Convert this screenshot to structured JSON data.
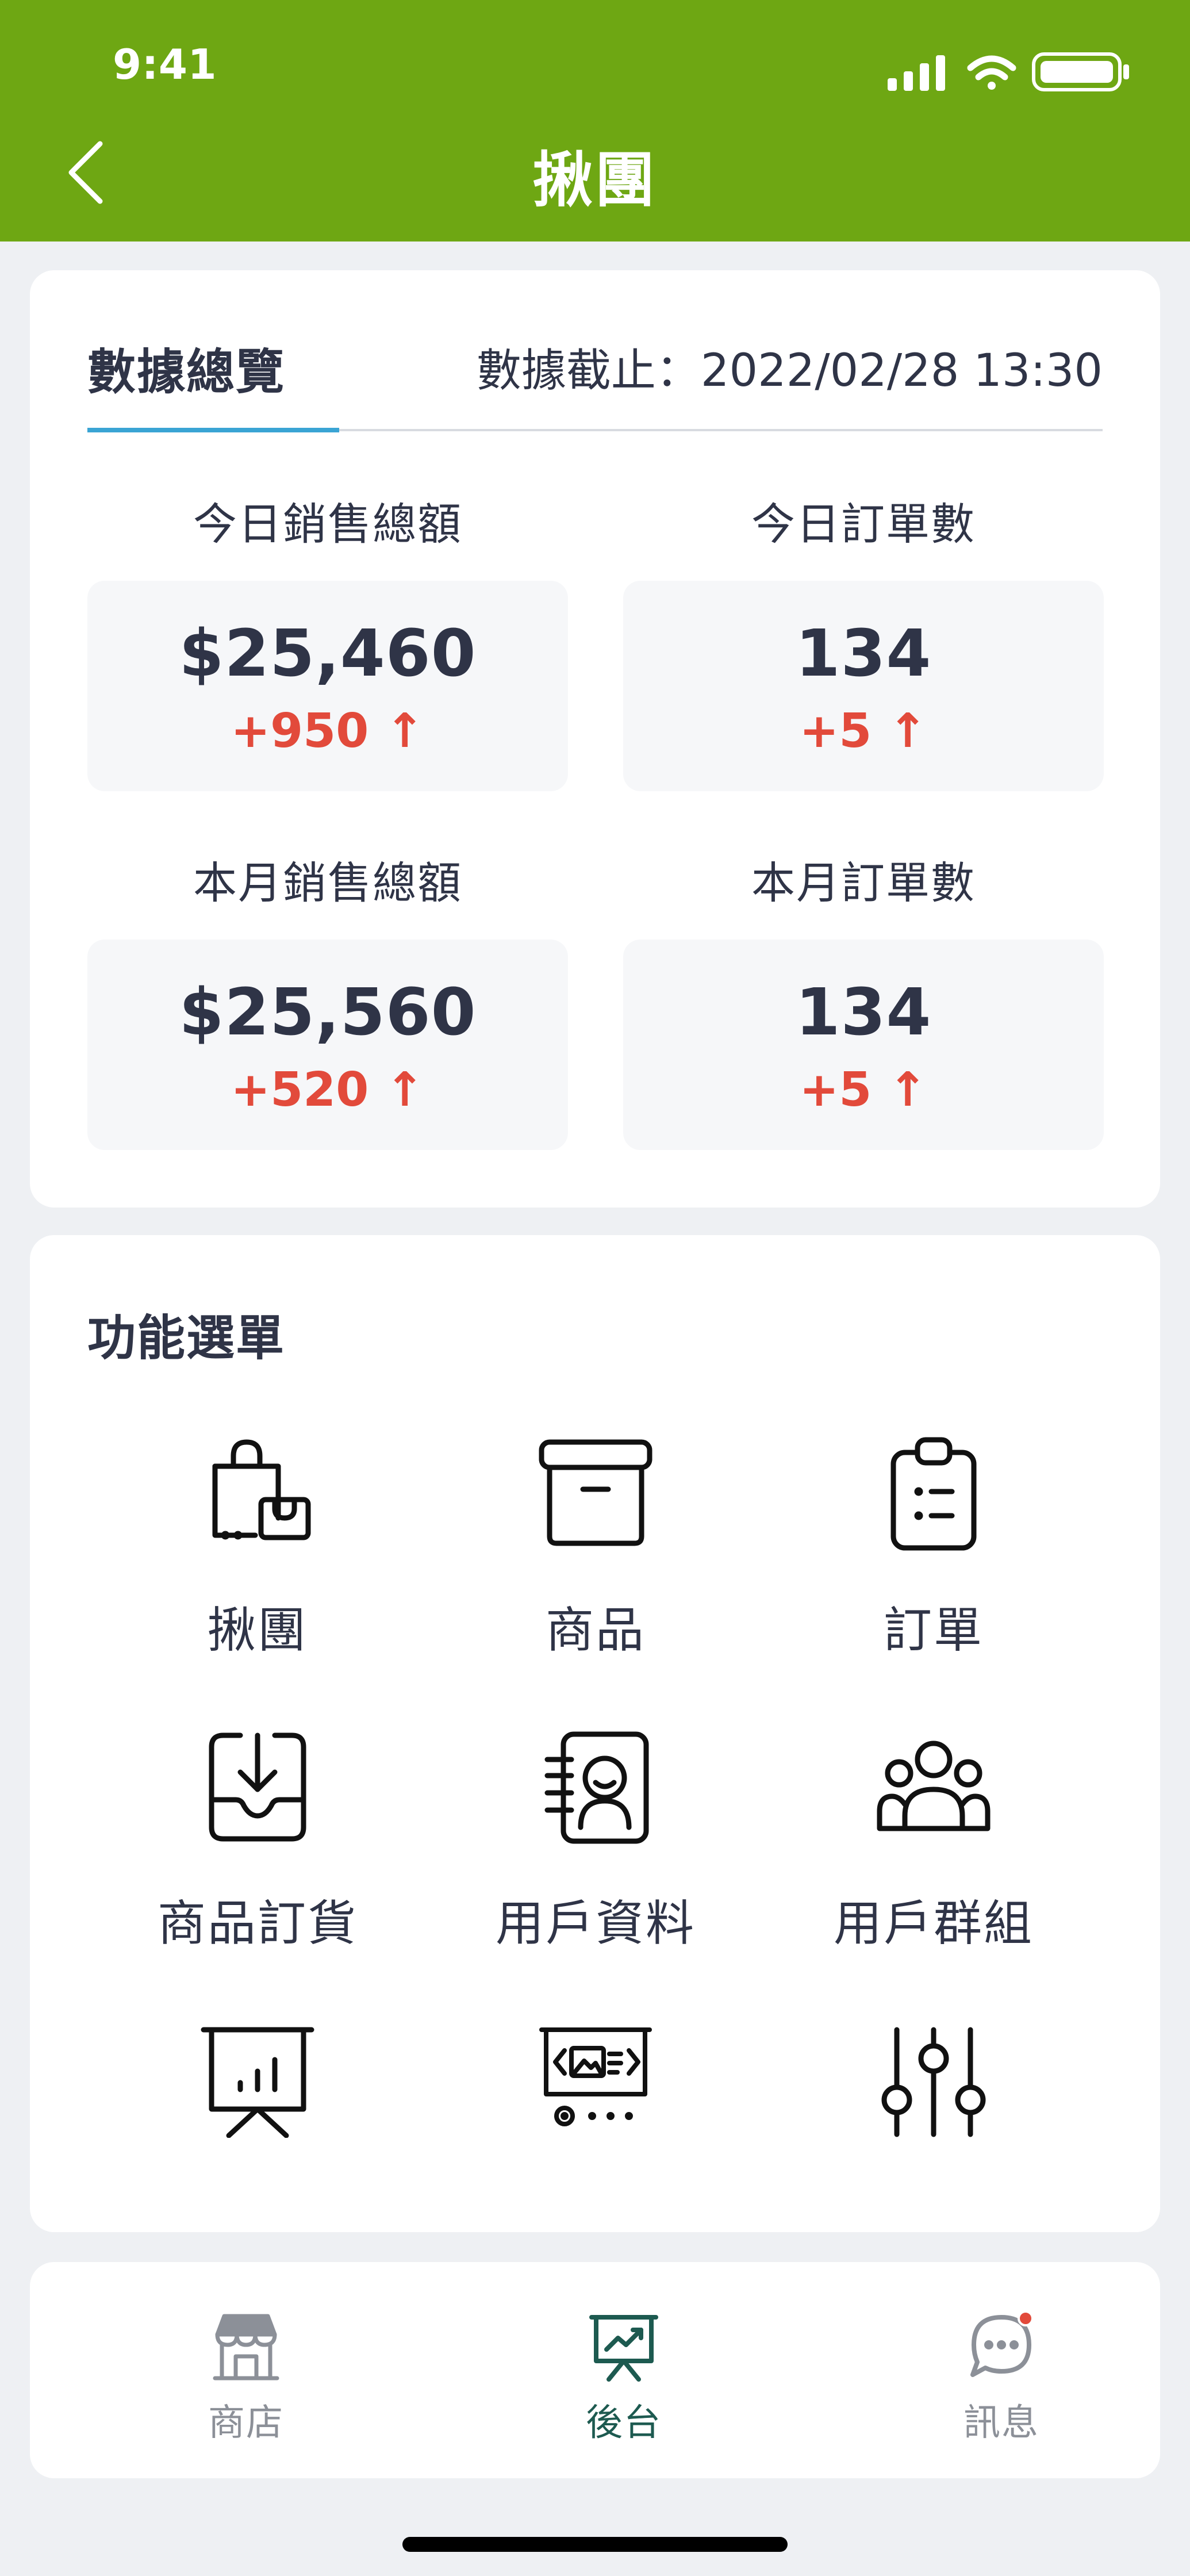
{
  "status_bar": {
    "time": "9:41"
  },
  "header": {
    "title": "揪團",
    "back_icon": "chevron-left-icon"
  },
  "overview": {
    "title": "數據總覽",
    "updated_at": "數據截止：2022/02/28 13:30",
    "metrics": [
      {
        "label": "今日銷售總額",
        "value": "$25,460",
        "change": "+950 ↑"
      },
      {
        "label": "今日訂單數",
        "value": "134",
        "change": "+5 ↑"
      },
      {
        "label": "本月銷售總額",
        "value": "$25,560",
        "change": "+520 ↑"
      },
      {
        "label": "本月訂單數",
        "value": "134",
        "change": "+5 ↑"
      }
    ]
  },
  "menu": {
    "title": "功能選單",
    "items": [
      {
        "label": "揪團",
        "icon": "shopping-bag-icon"
      },
      {
        "label": "商品",
        "icon": "archive-box-icon"
      },
      {
        "label": "訂單",
        "icon": "clipboard-list-icon"
      },
      {
        "label": "商品訂貨",
        "icon": "inbox-download-icon"
      },
      {
        "label": "用戶資料",
        "icon": "contact-book-icon"
      },
      {
        "label": "用戶群組",
        "icon": "user-group-icon"
      },
      {
        "icon": "presentation-chart-icon"
      },
      {
        "icon": "media-screen-icon"
      },
      {
        "icon": "sliders-icon"
      }
    ]
  },
  "bottom_nav": {
    "items": [
      {
        "label": "商店",
        "icon": "storefront-icon",
        "active": false
      },
      {
        "label": "後台",
        "icon": "dashboard-chart-icon",
        "active": true
      },
      {
        "label": "訊息",
        "icon": "chat-bubble-icon",
        "active": false
      }
    ]
  },
  "colors": {
    "header_bg": "#6ea713",
    "tab_underline": "#3aa4d4",
    "change_up": "#e24a3b",
    "nav_active": "#1d5a50",
    "notification_dot": "#e24a3b"
  }
}
